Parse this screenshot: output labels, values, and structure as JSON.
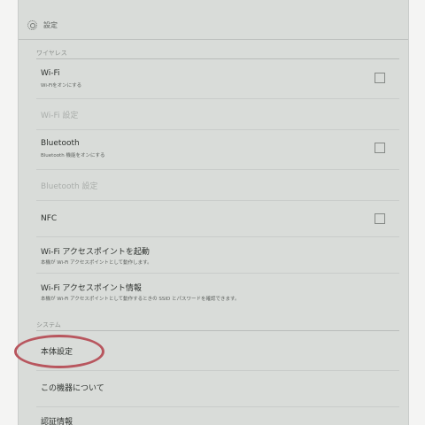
{
  "titlebar": {
    "title": "設定",
    "icon": "gear-icon"
  },
  "sections": {
    "wireless": "ワイヤレス",
    "system": "システム"
  },
  "rows": {
    "wifi": {
      "label": "Wi-Fi",
      "sub": "Wi-Fiをオンにする",
      "checked": false
    },
    "wifi_settings": {
      "label": "Wi-Fi 設定"
    },
    "bluetooth": {
      "label": "Bluetooth",
      "sub": "Bluetooth 機能をオンにする",
      "checked": false
    },
    "bluetooth_settings": {
      "label": "Bluetooth 設定"
    },
    "nfc": {
      "label": "NFC",
      "checked": false
    },
    "ap_start": {
      "label": "Wi-Fi アクセスポイントを起動",
      "sub": "本機が Wi-Fi アクセスポイントとして動作します。"
    },
    "ap_info": {
      "label": "Wi-Fi アクセスポイント情報",
      "sub": "本機が Wi-Fi アクセスポイントとして動作するときの SSID とパスワードを確認できます。"
    },
    "device_settings": {
      "label": "本体設定"
    },
    "about": {
      "label": "この機器について"
    },
    "certification": {
      "label": "認証情報"
    }
  },
  "colors": {
    "highlight": "#b8565e",
    "background": "#d9dcd9"
  }
}
